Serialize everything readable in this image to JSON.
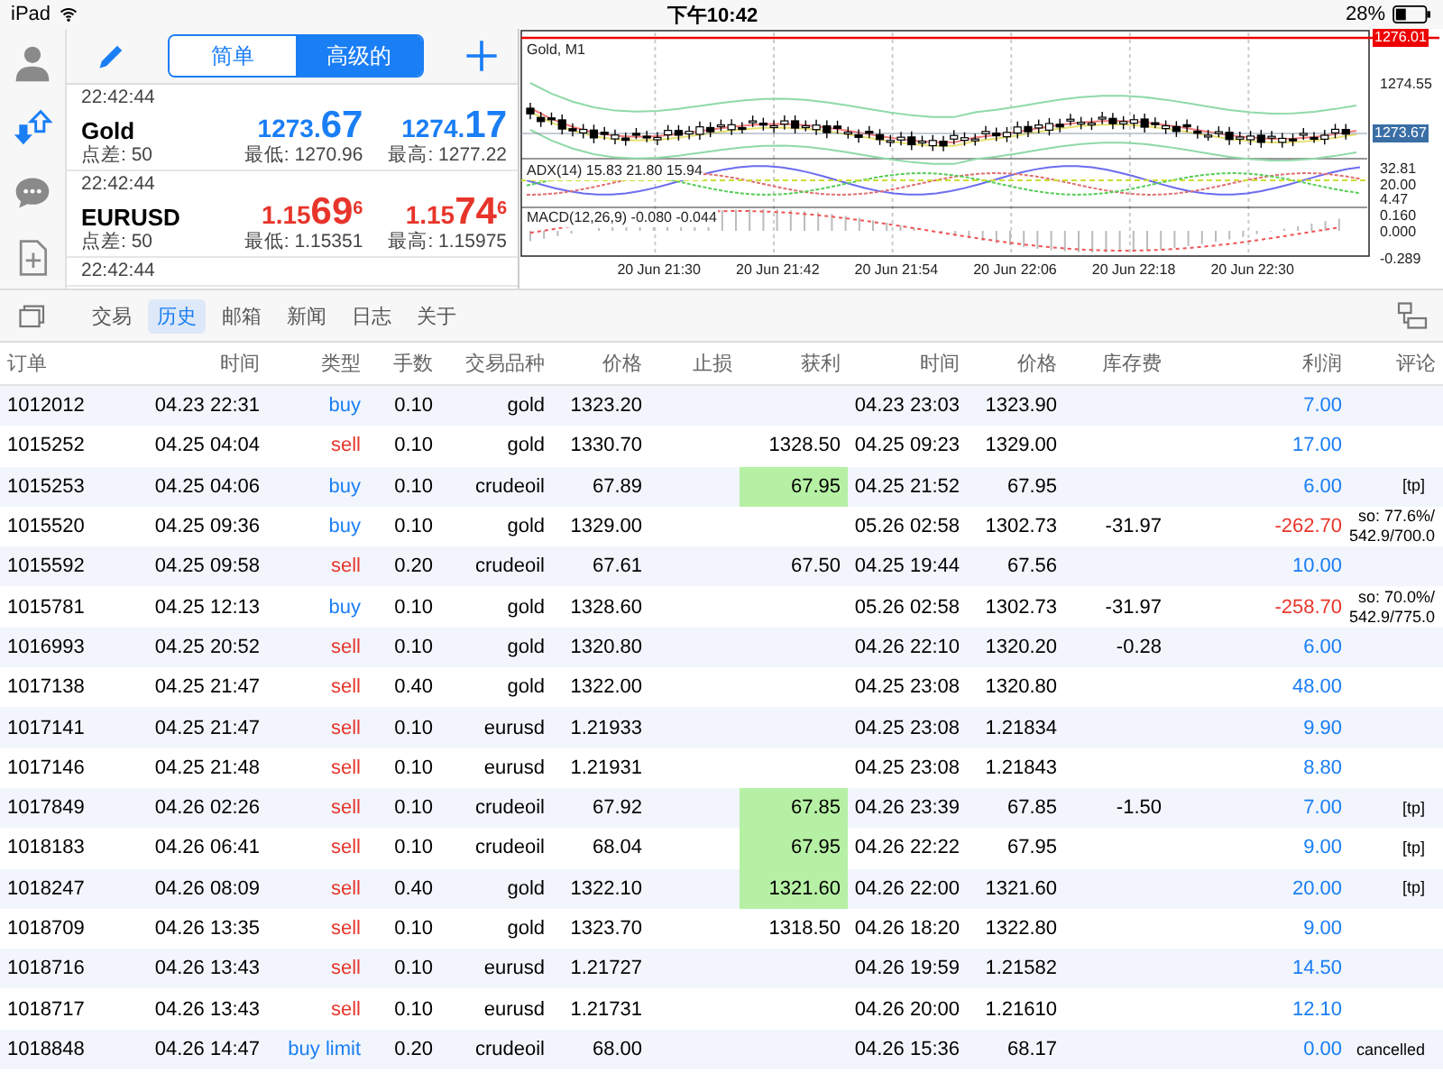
{
  "status_bar": {
    "device": "iPad",
    "time": "下午10:42",
    "battery": "28%"
  },
  "sidebar": {
    "items": [
      {
        "selected": false
      },
      {
        "selected": true
      },
      {
        "selected": false
      },
      {
        "selected": false
      }
    ]
  },
  "quotes": {
    "mode_tabs": [
      {
        "label": "简单",
        "selected": false
      },
      {
        "label": "高级的",
        "selected": true
      }
    ],
    "rows": [
      {
        "time": "22:42:44",
        "symbol": "Gold",
        "spread": "点差: 50",
        "color": "#1a7ef5",
        "bid": {
          "prefix": "1273.",
          "big": "67"
        },
        "ask": {
          "prefix": "1274.",
          "big": "17"
        },
        "low": "最低: 1270.96",
        "high": "最高: 1277.22"
      },
      {
        "time": "22:42:44",
        "symbol": "EURUSD",
        "spread": "点差: 50",
        "color": "#e8352b",
        "bid": {
          "prefix": "1.15",
          "big": "69",
          "sup": "6"
        },
        "ask": {
          "prefix": "1.15",
          "big": "74",
          "sup": "6"
        },
        "low": "最低: 1.15351",
        "high": "最高: 1.15975"
      },
      {
        "time": "22:42:44"
      }
    ]
  },
  "chart": {
    "title": "Gold, M1",
    "line_label": "1276.01",
    "price_labels": [
      "1274.55"
    ],
    "current_label": "1273.67",
    "adx": {
      "title": "ADX(14) 15.83 21.80 15.94",
      "labels": [
        "32.81",
        "20.00",
        "4.47"
      ]
    },
    "macd": {
      "title": "MACD(12,26,9) -0.080 -0.044",
      "labels": [
        "0.160",
        "0.000",
        "-0.289"
      ]
    },
    "x_labels": [
      "20 Jun 21:30",
      "20 Jun 21:42",
      "20 Jun 21:54",
      "20 Jun 22:06",
      "20 Jun 22:18",
      "20 Jun 22:30"
    ]
  },
  "tabs": [
    {
      "label": "交易",
      "selected": false
    },
    {
      "label": "历史",
      "selected": true
    },
    {
      "label": "邮箱",
      "selected": false
    },
    {
      "label": "新闻",
      "selected": false
    },
    {
      "label": "日志",
      "selected": false
    },
    {
      "label": "关于",
      "selected": false
    }
  ],
  "table": {
    "columns": [
      "订单",
      "时间",
      "类型",
      "手数",
      "交易品种",
      "价格",
      "止损",
      "获利",
      "时间",
      "价格",
      "库存费",
      "利润",
      "评论"
    ],
    "rows": [
      {
        "order": "1012012",
        "open_time": "04.23 22:31",
        "type": {
          "text": "buy",
          "color": "#1a7ef5"
        },
        "lots": "0.10",
        "symbol": "gold",
        "price": "1323.20",
        "close_time": "04.23 23:03",
        "close_price": "1323.90",
        "profit": {
          "text": "7.00",
          "color": "#1a7ef5"
        }
      },
      {
        "order": "1015252",
        "open_time": "04.25 04:04",
        "type": {
          "text": "sell",
          "color": "#e8352b"
        },
        "lots": "0.10",
        "symbol": "gold",
        "price": "1330.70",
        "tp": {
          "text": "1328.50",
          "hit": false
        },
        "close_time": "04.25 09:23",
        "close_price": "1329.00",
        "profit": {
          "text": "17.00",
          "color": "#1a7ef5"
        }
      },
      {
        "order": "1015253",
        "open_time": "04.25 04:06",
        "type": {
          "text": "buy",
          "color": "#1a7ef5"
        },
        "lots": "0.10",
        "symbol": "crudeoil",
        "price": "67.89",
        "tp": {
          "text": "67.95",
          "hit": true
        },
        "close_time": "04.25 21:52",
        "close_price": "67.95",
        "profit": {
          "text": "6.00",
          "color": "#1a7ef5"
        },
        "comment": "[tp]"
      },
      {
        "order": "1015520",
        "open_time": "04.25 09:36",
        "type": {
          "text": "buy",
          "color": "#1a7ef5"
        },
        "lots": "0.10",
        "symbol": "gold",
        "price": "1329.00",
        "close_time": "05.26 02:58",
        "close_price": "1302.73",
        "swap": "-31.97",
        "profit": {
          "text": "-262.70",
          "color": "#e8352b"
        },
        "comment": "so: 77.6%/ 542.9/700.0"
      },
      {
        "order": "1015592",
        "open_time": "04.25 09:58",
        "type": {
          "text": "sell",
          "color": "#e8352b"
        },
        "lots": "0.20",
        "symbol": "crudeoil",
        "price": "67.61",
        "tp": {
          "text": "67.50",
          "hit": false
        },
        "close_time": "04.25 19:44",
        "close_price": "67.56",
        "profit": {
          "text": "10.00",
          "color": "#1a7ef5"
        }
      },
      {
        "order": "1015781",
        "open_time": "04.25 12:13",
        "type": {
          "text": "buy",
          "color": "#1a7ef5"
        },
        "lots": "0.10",
        "symbol": "gold",
        "price": "1328.60",
        "close_time": "05.26 02:58",
        "close_price": "1302.73",
        "swap": "-31.97",
        "profit": {
          "text": "-258.70",
          "color": "#e8352b"
        },
        "comment": "so: 70.0%/ 542.9/775.0"
      },
      {
        "order": "1016993",
        "open_time": "04.25 20:52",
        "type": {
          "text": "sell",
          "color": "#e8352b"
        },
        "lots": "0.10",
        "symbol": "gold",
        "price": "1320.80",
        "close_time": "04.26 22:10",
        "close_price": "1320.20",
        "swap": "-0.28",
        "profit": {
          "text": "6.00",
          "color": "#1a7ef5"
        }
      },
      {
        "order": "1017138",
        "open_time": "04.25 21:47",
        "type": {
          "text": "sell",
          "color": "#e8352b"
        },
        "lots": "0.40",
        "symbol": "gold",
        "price": "1322.00",
        "close_time": "04.25 23:08",
        "close_price": "1320.80",
        "profit": {
          "text": "48.00",
          "color": "#1a7ef5"
        }
      },
      {
        "order": "1017141",
        "open_time": "04.25 21:47",
        "type": {
          "text": "sell",
          "color": "#e8352b"
        },
        "lots": "0.10",
        "symbol": "eurusd",
        "price": "1.21933",
        "close_time": "04.25 23:08",
        "close_price": "1.21834",
        "profit": {
          "text": "9.90",
          "color": "#1a7ef5"
        }
      },
      {
        "order": "1017146",
        "open_time": "04.25 21:48",
        "type": {
          "text": "sell",
          "color": "#e8352b"
        },
        "lots": "0.10",
        "symbol": "eurusd",
        "price": "1.21931",
        "close_time": "04.25 23:08",
        "close_price": "1.21843",
        "profit": {
          "text": "8.80",
          "color": "#1a7ef5"
        }
      },
      {
        "order": "1017849",
        "open_time": "04.26 02:26",
        "type": {
          "text": "sell",
          "color": "#e8352b"
        },
        "lots": "0.10",
        "symbol": "crudeoil",
        "price": "67.92",
        "tp": {
          "text": "67.85",
          "hit": true
        },
        "close_time": "04.26 23:39",
        "close_price": "67.85",
        "swap": "-1.50",
        "profit": {
          "text": "7.00",
          "color": "#1a7ef5"
        },
        "comment": "[tp]"
      },
      {
        "order": "1018183",
        "open_time": "04.26 06:41",
        "type": {
          "text": "sell",
          "color": "#e8352b"
        },
        "lots": "0.10",
        "symbol": "crudeoil",
        "price": "68.04",
        "tp": {
          "text": "67.95",
          "hit": true
        },
        "close_time": "04.26 22:22",
        "close_price": "67.95",
        "profit": {
          "text": "9.00",
          "color": "#1a7ef5"
        },
        "comment": "[tp]"
      },
      {
        "order": "1018247",
        "open_time": "04.26 08:09",
        "type": {
          "text": "sell",
          "color": "#e8352b"
        },
        "lots": "0.40",
        "symbol": "gold",
        "price": "1322.10",
        "tp": {
          "text": "1321.60",
          "hit": true
        },
        "close_time": "04.26 22:00",
        "close_price": "1321.60",
        "profit": {
          "text": "20.00",
          "color": "#1a7ef5"
        },
        "comment": "[tp]"
      },
      {
        "order": "1018709",
        "open_time": "04.26 13:35",
        "type": {
          "text": "sell",
          "color": "#e8352b"
        },
        "lots": "0.10",
        "symbol": "gold",
        "price": "1323.70",
        "tp": {
          "text": "1318.50",
          "hit": false
        },
        "close_time": "04.26 18:20",
        "close_price": "1322.80",
        "profit": {
          "text": "9.00",
          "color": "#1a7ef5"
        }
      },
      {
        "order": "1018716",
        "open_time": "04.26 13:43",
        "type": {
          "text": "sell",
          "color": "#e8352b"
        },
        "lots": "0.10",
        "symbol": "eurusd",
        "price": "1.21727",
        "close_time": "04.26 19:59",
        "close_price": "1.21582",
        "profit": {
          "text": "14.50",
          "color": "#1a7ef5"
        }
      },
      {
        "order": "1018717",
        "open_time": "04.26 13:43",
        "type": {
          "text": "sell",
          "color": "#e8352b"
        },
        "lots": "0.10",
        "symbol": "eurusd",
        "price": "1.21731",
        "close_time": "04.26 20:00",
        "close_price": "1.21610",
        "profit": {
          "text": "12.10",
          "color": "#1a7ef5"
        }
      },
      {
        "order": "1018848",
        "open_time": "04.26 14:47",
        "type": {
          "text": "buy limit",
          "color": "#1a7ef5"
        },
        "lots": "0.20",
        "symbol": "crudeoil",
        "price": "68.00",
        "close_time": "04.26 15:36",
        "close_price": "68.17",
        "profit": {
          "text": "0.00",
          "color": "#1a7ef5"
        },
        "comment": "cancelled"
      }
    ]
  }
}
